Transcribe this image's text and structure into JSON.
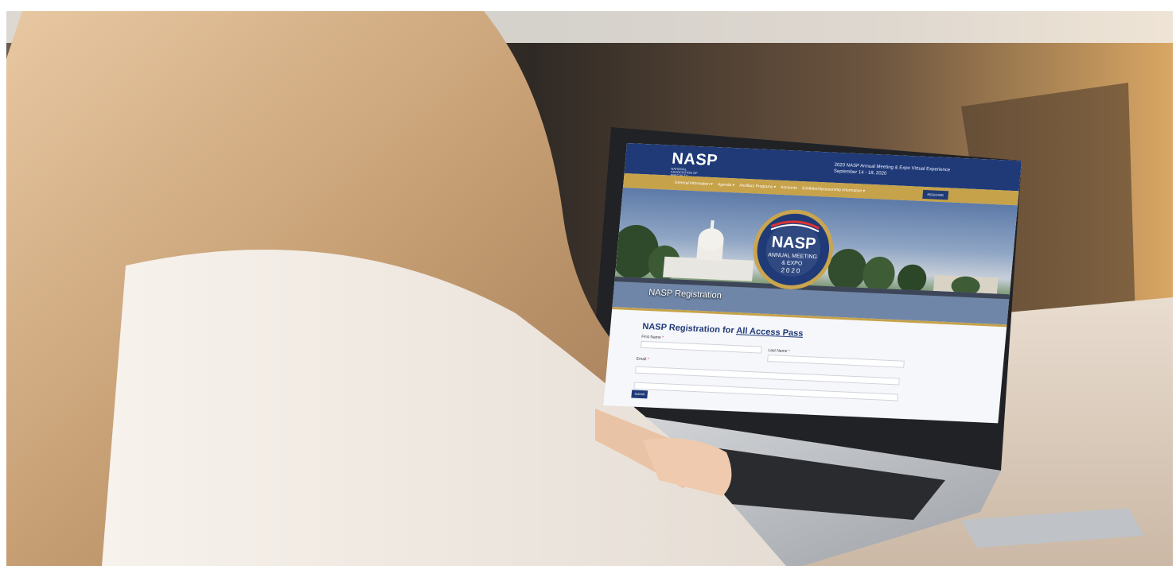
{
  "screen": {
    "logo": "NASP",
    "logo_subtitle": "NATIONAL ASSOCIATION OF SPECIALTY PHARMACY",
    "event_title_line1": "2020 NASP Annual Meeting & Expo Virtual Experience",
    "event_title_line2": "September 14 - 18, 2020",
    "nav": [
      "General Information ▾",
      "Agenda ▾",
      "Ancillary Programs ▾",
      "Accounts",
      "Exhibitor/Sponsorship Information ▾"
    ],
    "register_label": "REGISTER",
    "hero_caption": "NASP Registration",
    "badge": {
      "name": "NASP",
      "line1": "ANNUAL MEETING",
      "line2": "& EXPO",
      "year": "2020"
    },
    "form": {
      "title_prefix": "NASP Registration for ",
      "title_pass": "All Access Pass",
      "first_name": "First Name",
      "last_name": "Last Name",
      "email": "Email",
      "required_mark": "*",
      "submit": "Submit"
    }
  },
  "colors": {
    "navy": "#1f3a77",
    "gold": "#c6a24a",
    "hair": "#c9a27a",
    "sweater": "#f1ece6"
  }
}
